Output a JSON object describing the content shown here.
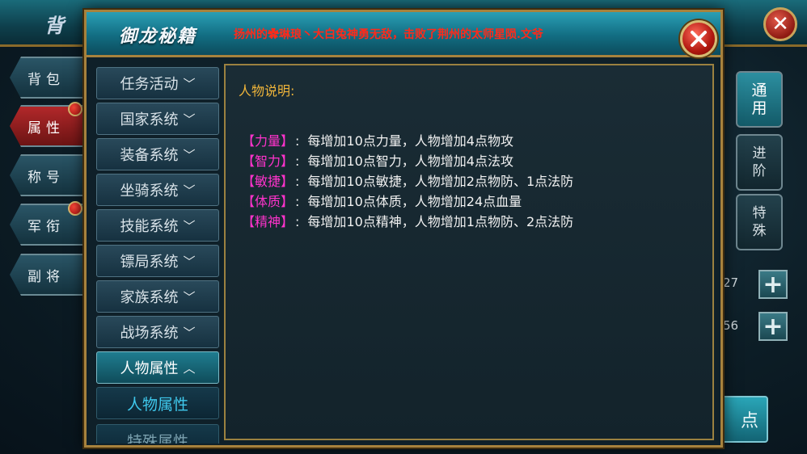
{
  "background_window": {
    "title": "背 包",
    "side_tabs": [
      {
        "label": "背包"
      },
      {
        "label": "属性"
      },
      {
        "label": "称号"
      },
      {
        "label": "军衔"
      },
      {
        "label": "副将"
      }
    ],
    "right_tabs": [
      {
        "label": "通用"
      },
      {
        "label": "进阶"
      },
      {
        "label": "特殊"
      }
    ],
    "stat_values": [
      "27",
      "56"
    ],
    "confirm_label": "点"
  },
  "modal": {
    "title": "御龙秘籍",
    "marquee": "扬州的✿琳琅丶大白兔神勇无敌，击败了荆州的太师星陨.文爷",
    "menu": {
      "items": [
        {
          "label": "任务活动",
          "chevron": "﹀"
        },
        {
          "label": "国家系统",
          "chevron": "﹀"
        },
        {
          "label": "装备系统",
          "chevron": "﹀"
        },
        {
          "label": "坐骑系统",
          "chevron": "﹀"
        },
        {
          "label": "技能系统",
          "chevron": "﹀"
        },
        {
          "label": "镖局系统",
          "chevron": "﹀"
        },
        {
          "label": "家族系统",
          "chevron": "﹀"
        },
        {
          "label": "战场系统",
          "chevron": "﹀"
        },
        {
          "label": "人物属性",
          "chevron": "︿"
        }
      ],
      "sub_items": [
        {
          "label": "人物属性"
        },
        {
          "label": "特殊属性"
        }
      ]
    },
    "content": {
      "heading": "人物说明:",
      "attributes": [
        {
          "name": "【力量】",
          "sep": ":",
          "desc": "每增加10点力量，人物增加4点物攻"
        },
        {
          "name": "【智力】",
          "sep": ":",
          "desc": "每增加10点智力，人物增加4点法攻"
        },
        {
          "name": "【敏捷】",
          "sep": ":",
          "desc": "每增加10点敏捷，人物增加2点物防、1点法防"
        },
        {
          "name": "【体质】",
          "sep": ":",
          "desc": "每增加10点体质，人物增加24点血量"
        },
        {
          "name": "【精神】",
          "sep": ":",
          "desc": "每增加10点精神，人物增加1点物防、2点法防"
        }
      ]
    }
  },
  "colors": {
    "accent_gold": "#f0b53a",
    "attribute_magenta": "#ff33cc",
    "marquee_red": "#ff2a1a",
    "active_submenu_cyan": "#3fc8ec"
  }
}
